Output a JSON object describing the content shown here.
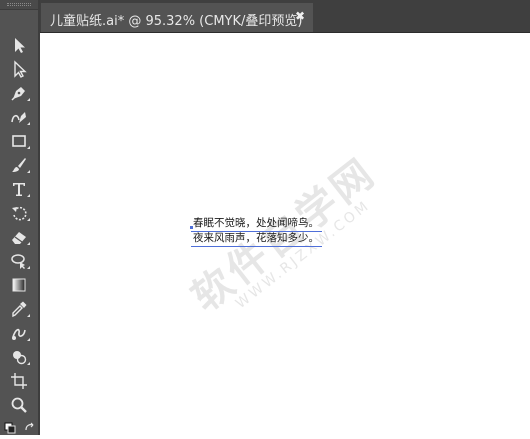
{
  "document_tab": {
    "label": "儿童贴纸.ai* @ 95.32% (CMYK/叠印预览)",
    "close_glyph": "✖"
  },
  "tools": [
    {
      "icon": "selection-tool-icon"
    },
    {
      "icon": "direct-selection-tool-icon"
    },
    {
      "icon": "pen-tool-icon"
    },
    {
      "icon": "curvature-tool-icon"
    },
    {
      "icon": "rectangle-tool-icon"
    },
    {
      "icon": "paintbrush-tool-icon"
    },
    {
      "icon": "type-tool-icon"
    },
    {
      "icon": "rotate-tool-icon"
    },
    {
      "icon": "eraser-tool-icon"
    },
    {
      "icon": "lasso-tool-icon"
    },
    {
      "icon": "gradient-tool-icon"
    },
    {
      "icon": "eyedropper-tool-icon"
    },
    {
      "icon": "blend-tool-icon"
    },
    {
      "icon": "shape-builder-tool-icon"
    },
    {
      "icon": "artboard-tool-icon"
    },
    {
      "icon": "zoom-tool-icon"
    },
    {
      "icon": "swap-colors-icon"
    }
  ],
  "canvas_text": {
    "line1": "春眠不觉晓，处处闻啼鸟。",
    "line2": "夜来风雨声，花落知多少。"
  },
  "watermark": {
    "main": "软件自学网",
    "sub": "WWW.RJZXW.COM"
  },
  "colors": {
    "toolbar_bg": "#535353",
    "tabbar_bg": "#3f3f3f",
    "text_selection": "#4f6fd8"
  }
}
